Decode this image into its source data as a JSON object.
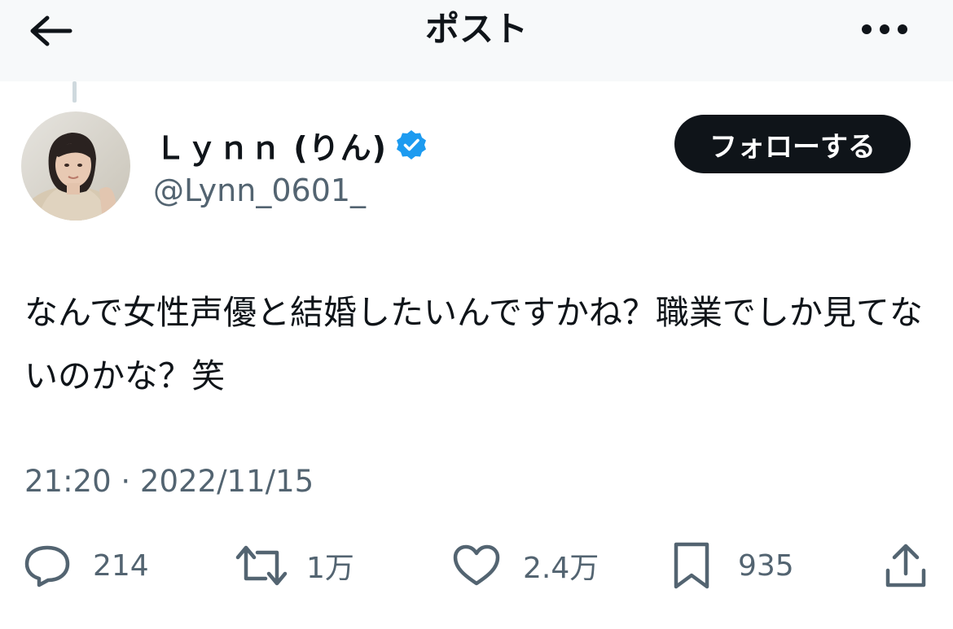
{
  "header": {
    "title": "ポスト",
    "back_icon": "arrow-left-icon",
    "more_icon": "more-horizontal-icon"
  },
  "author": {
    "display_name": "Ｌｙｎｎ (りん)",
    "handle": "@Lynn_0601_",
    "verified": true,
    "verified_color": "#1d9bf0"
  },
  "follow_button": {
    "label": "フォローする"
  },
  "tweet": {
    "text": "なんで女性声優と結婚したいんですかね？職業でしか見てないのかな？笑",
    "timestamp": "21:20 · 2022/11/15"
  },
  "actions": {
    "replies": "214",
    "reposts": "1万",
    "likes": "2.4万",
    "bookmarks": "935"
  },
  "colors": {
    "text_primary": "#0f1419",
    "text_secondary": "#536471",
    "header_bg": "#f7f9fa",
    "follow_bg": "#0f1419"
  }
}
